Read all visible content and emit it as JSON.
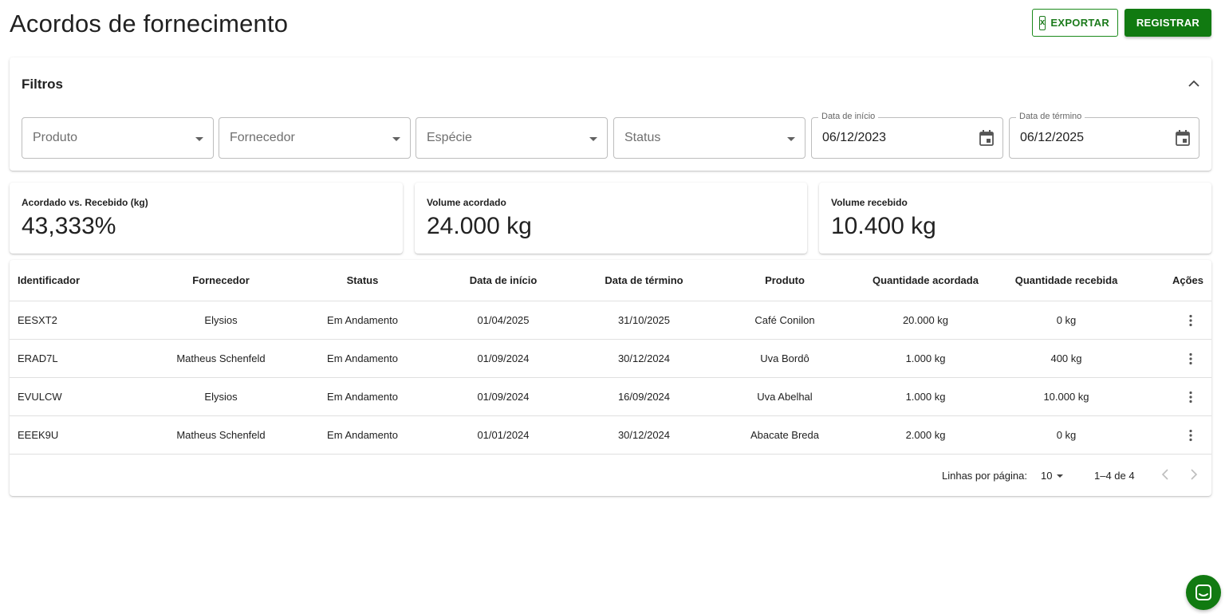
{
  "header": {
    "title": "Acordos de fornecimento",
    "export_label": "EXPORTAR",
    "register_label": "REGISTRAR"
  },
  "filters": {
    "title": "Filtros",
    "product_placeholder": "Produto",
    "supplier_placeholder": "Fornecedor",
    "species_placeholder": "Espécie",
    "status_placeholder": "Status",
    "start_date_label": "Data de início",
    "start_date_value": "06/12/2023",
    "end_date_label": "Data de término",
    "end_date_value": "06/12/2025"
  },
  "stats": [
    {
      "label": "Acordado vs. Recebido (kg)",
      "value": "43,333%"
    },
    {
      "label": "Volume acordado",
      "value": "24.000 kg"
    },
    {
      "label": "Volume recebido",
      "value": "10.400 kg"
    }
  ],
  "table": {
    "columns": [
      "Identificador",
      "Fornecedor",
      "Status",
      "Data de início",
      "Data de término",
      "Produto",
      "Quantidade acordada",
      "Quantidade recebida",
      "Ações"
    ],
    "rows": [
      [
        "EESXT2",
        "Elysios",
        "Em Andamento",
        "01/04/2025",
        "31/10/2025",
        "Café Conilon",
        "20.000 kg",
        "0 kg"
      ],
      [
        "ERAD7L",
        "Matheus Schenfeld",
        "Em Andamento",
        "01/09/2024",
        "30/12/2024",
        "Uva Bordô",
        "1.000 kg",
        "400 kg"
      ],
      [
        "EVULCW",
        "Elysios",
        "Em Andamento",
        "01/09/2024",
        "16/09/2024",
        "Uva Abelhal",
        "1.000 kg",
        "10.000 kg"
      ],
      [
        "EEEK9U",
        "Matheus Schenfeld",
        "Em Andamento",
        "01/01/2024",
        "30/12/2024",
        "Abacate Breda",
        "2.000 kg",
        "0 kg"
      ]
    ]
  },
  "pagination": {
    "rows_per_page_label": "Linhas por página:",
    "rows_per_page_value": "10",
    "range": "1–4 de 4"
  },
  "colors": {
    "primary": "#117a11",
    "border": "#bdbdbd",
    "text": "#212121"
  },
  "icons": {
    "export": "excel-icon",
    "collapse": "chevron-up-icon",
    "calendar": "calendar-icon",
    "row_actions": "more-vert-icon",
    "prev": "chevron-left-icon",
    "next": "chevron-right-icon",
    "chat": "chat-icon"
  }
}
